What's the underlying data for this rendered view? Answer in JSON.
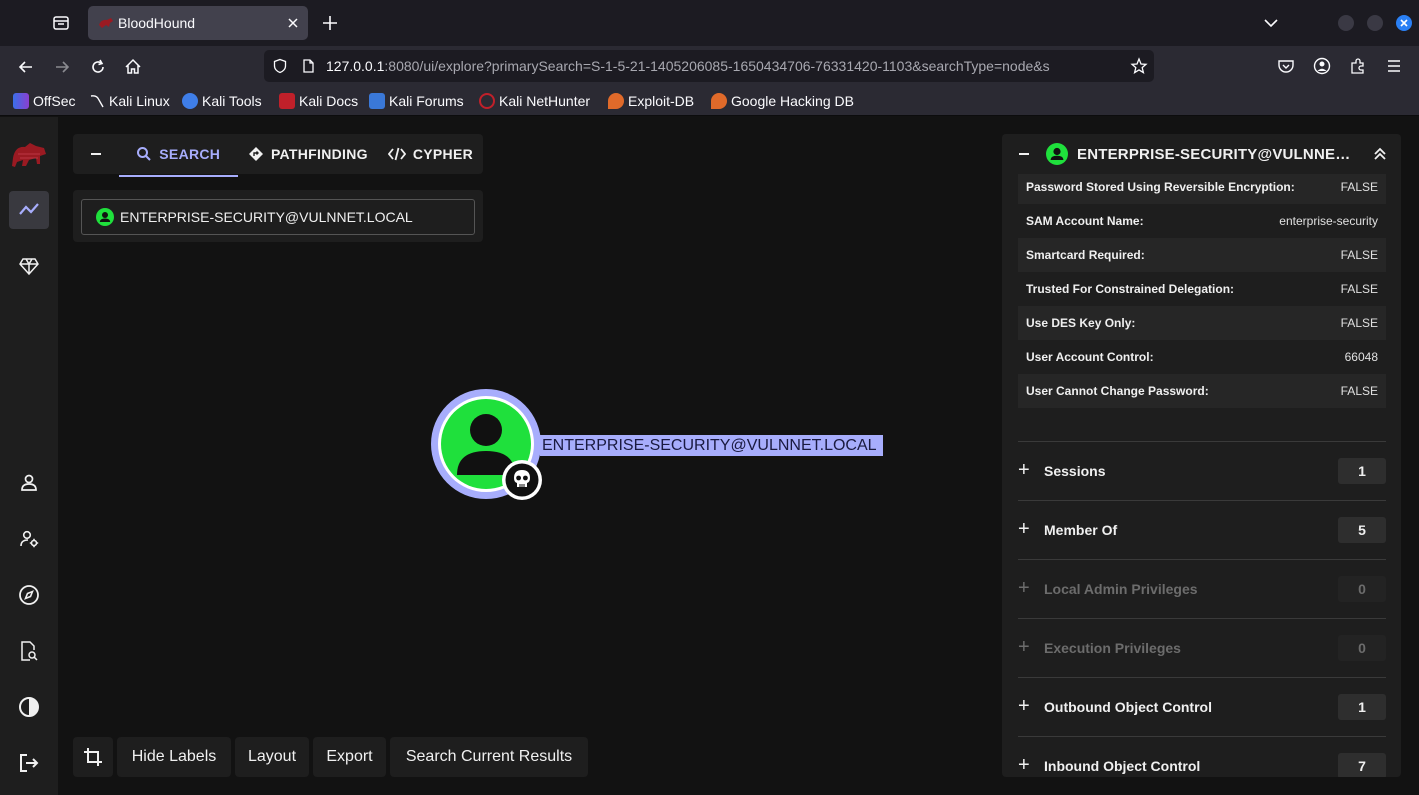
{
  "browser": {
    "tab_title": "BloodHound",
    "url_host": "127.0.0.1",
    "url_rest": ":8080/ui/explore?primarySearch=S-1-5-21-1405206085-1650434706-76331420-1103&searchType=node&s",
    "bookmarks": [
      "OffSec",
      "Kali Linux",
      "Kali Tools",
      "Kali Docs",
      "Kali Forums",
      "Kali NetHunter",
      "Exploit-DB",
      "Google Hacking DB"
    ]
  },
  "search": {
    "tabs": [
      "SEARCH",
      "PATHFINDING",
      "CYPHER"
    ],
    "value": "ENTERPRISE-SECURITY@VULNNET.LOCAL"
  },
  "graph": {
    "node_label": "ENTERPRISE-SECURITY@VULNNET.LOCAL"
  },
  "toolbar": {
    "hide_labels": "Hide Labels",
    "layout": "Layout",
    "export": "Export",
    "search_results": "Search Current Results"
  },
  "entity": {
    "title": "ENTERPRISE-SECURITY@VULNNET.LOCAL",
    "properties": [
      {
        "k": "Password Stored Using Reversible Encryption:",
        "v": "FALSE"
      },
      {
        "k": "SAM Account Name:",
        "v": "enterprise-security"
      },
      {
        "k": "Smartcard Required:",
        "v": "FALSE"
      },
      {
        "k": "Trusted For Constrained Delegation:",
        "v": "FALSE"
      },
      {
        "k": "Use DES Key Only:",
        "v": "FALSE"
      },
      {
        "k": "User Account Control:",
        "v": "66048"
      },
      {
        "k": "User Cannot Change Password:",
        "v": "FALSE"
      }
    ],
    "sections": [
      {
        "label": "Sessions",
        "count": "1"
      },
      {
        "label": "Member Of",
        "count": "5"
      },
      {
        "label": "Local Admin Privileges",
        "count": "0"
      },
      {
        "label": "Execution Privileges",
        "count": "0"
      },
      {
        "label": "Outbound Object Control",
        "count": "1"
      },
      {
        "label": "Inbound Object Control",
        "count": "7"
      }
    ]
  },
  "colors": {
    "accent": "#a7adfc",
    "node_green": "#1fe03c",
    "panel": "#1e1e1e"
  }
}
